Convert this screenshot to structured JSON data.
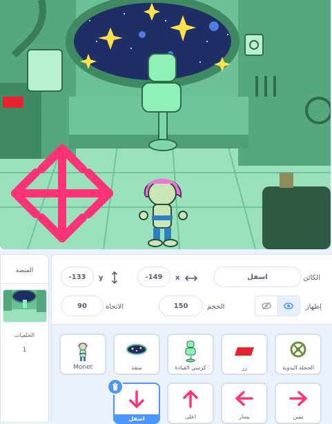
{
  "sprite": {
    "name_label": "الكائن",
    "name_value": "اسفل",
    "x_label": "x",
    "x_value": "-149",
    "y_label": "y",
    "y_value": "-133",
    "show_label": "إظهار",
    "size_label": "الحجم",
    "size_value": "150",
    "direction_label": "الاتجاه",
    "direction_value": "90"
  },
  "stage_panel": {
    "title": "المنصة",
    "backdrops_label": "الخلفيات",
    "backdrops_count": "1"
  },
  "sprites": [
    {
      "name": "الحجلة اليدوية",
      "icon": "handwheel-icon"
    },
    {
      "name": "زر",
      "icon": "red-button-icon"
    },
    {
      "name": "كرسي القيادة",
      "icon": "captain-chair-icon"
    },
    {
      "name": "منفذ",
      "icon": "porthole-icon"
    },
    {
      "name": "Monet",
      "icon": "monet-icon"
    },
    {
      "name": "يمين",
      "icon": "arrow-right-icon"
    },
    {
      "name": "يسار",
      "icon": "arrow-left-icon"
    },
    {
      "name": "اعلى",
      "icon": "arrow-up-icon"
    },
    {
      "name": "اسفل",
      "icon": "arrow-down-icon"
    }
  ],
  "colors": {
    "accent": "#4c97ff",
    "arrow": "#ff3377",
    "stage_bg": "#5fc898"
  }
}
